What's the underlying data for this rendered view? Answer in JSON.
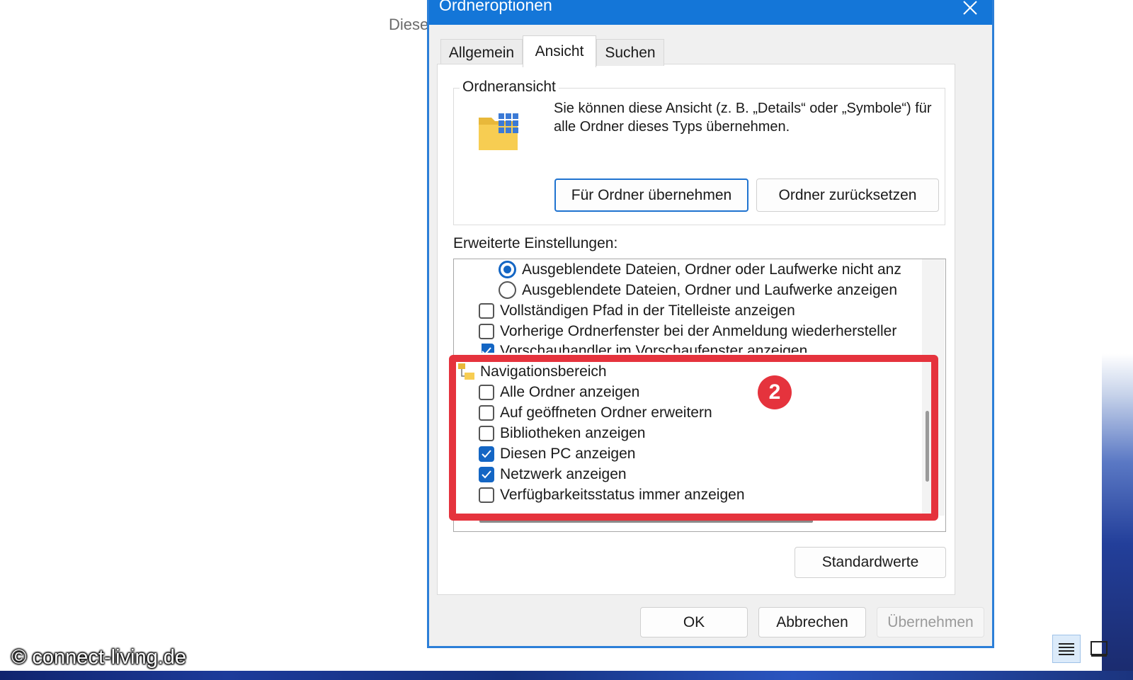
{
  "background": {
    "partial_text": "Diese",
    "watermark": "© connect-living.de"
  },
  "dialog": {
    "title": "Ordneroptionen",
    "tabs": [
      {
        "label": "Allgemein",
        "active": false
      },
      {
        "label": "Ansicht",
        "active": true
      },
      {
        "label": "Suchen",
        "active": false
      }
    ],
    "folder_view": {
      "group_label": "Ordneransicht",
      "description": "Sie können diese Ansicht (z. B. „Details“ oder „Symbole“) für alle Ordner dieses Typs übernehmen.",
      "apply_button": "Für Ordner übernehmen",
      "reset_button": "Ordner zurücksetzen"
    },
    "advanced": {
      "label": "Erweiterte Einstellungen:",
      "items": [
        {
          "type": "radio",
          "label": "Ausgeblendete Dateien, Ordner oder Laufwerke nicht anz",
          "checked": true
        },
        {
          "type": "radio",
          "label": "Ausgeblendete Dateien, Ordner und Laufwerke anzeigen",
          "checked": false
        },
        {
          "type": "checkbox",
          "label": "Vollständigen Pfad in der Titelleiste anzeigen",
          "checked": false
        },
        {
          "type": "checkbox",
          "label": "Vorherige Ordnerfenster bei der Anmeldung wiederhersteller",
          "checked": false
        },
        {
          "type": "checkbox",
          "label": "Vorschauhandler im Vorschaufenster anzeigen",
          "checked": true
        },
        {
          "type": "group",
          "label": "Navigationsbereich"
        },
        {
          "type": "checkbox",
          "label": "Alle Ordner anzeigen",
          "checked": false
        },
        {
          "type": "checkbox",
          "label": "Auf geöffneten Ordner erweitern",
          "checked": false
        },
        {
          "type": "checkbox",
          "label": "Bibliotheken anzeigen",
          "checked": false
        },
        {
          "type": "checkbox",
          "label": "Diesen PC anzeigen",
          "checked": true
        },
        {
          "type": "checkbox",
          "label": "Netzwerk anzeigen",
          "checked": true
        },
        {
          "type": "checkbox",
          "label": "Verfügbarkeitsstatus immer anzeigen",
          "checked": false
        }
      ]
    },
    "annotation_badge": "2",
    "defaults_button": "Standardwerte",
    "ok_button": "OK",
    "cancel_button": "Abbrechen",
    "apply_button": "Übernehmen"
  },
  "colors": {
    "accent": "#1476d8",
    "highlight": "#e5333d",
    "checked": "#1466c4"
  }
}
